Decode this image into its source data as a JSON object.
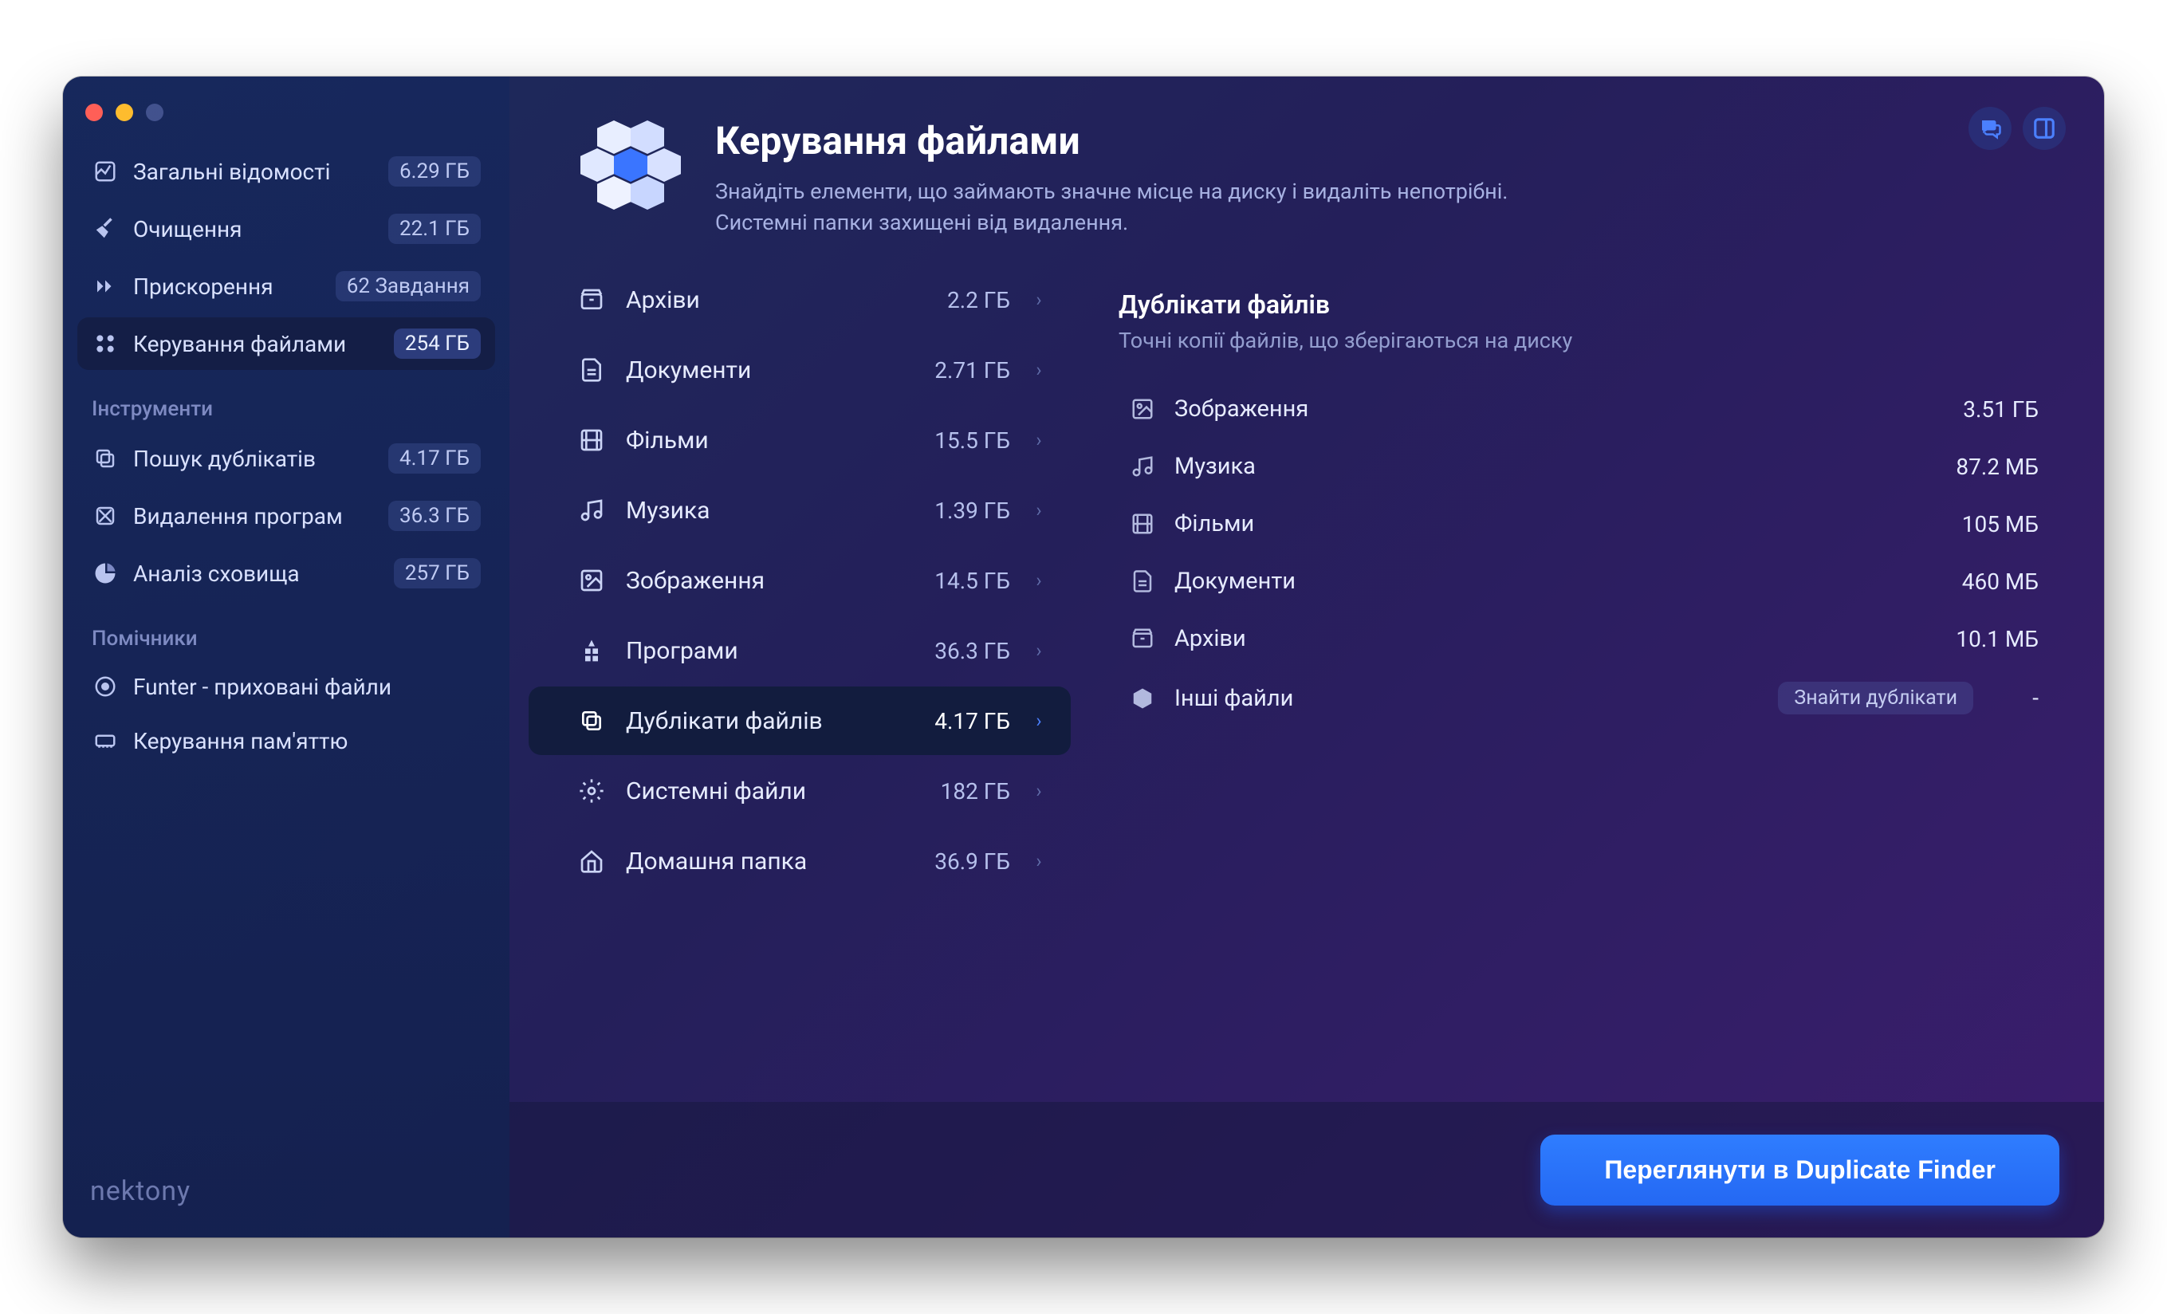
{
  "brand": "nektony",
  "sidebar": {
    "main": [
      {
        "label": "Загальні відомості",
        "size": "6.29 ГБ"
      },
      {
        "label": "Очищення",
        "size": "22.1 ГБ"
      },
      {
        "label": "Прискорення",
        "size": "62 Завдання"
      },
      {
        "label": "Керування файлами",
        "size": "254 ГБ"
      }
    ],
    "section_tools": "Інструменти",
    "tools": [
      {
        "label": "Пошук дублікатів",
        "size": "4.17 ГБ"
      },
      {
        "label": "Видалення програм",
        "size": "36.3 ГБ"
      },
      {
        "label": "Аналіз сховища",
        "size": "257 ГБ"
      }
    ],
    "section_helpers": "Помічники",
    "helpers": [
      {
        "label": "Funter - приховані файли"
      },
      {
        "label": "Керування пам'яттю"
      }
    ]
  },
  "header": {
    "title": "Керування файлами",
    "sub1": "Знайдіть елементи, що займають значне місце на диску і видаліть непотрібні.",
    "sub2": "Системні папки захищені від видалення."
  },
  "files": [
    {
      "label": "Архіви",
      "size": "2.2 ГБ"
    },
    {
      "label": "Документи",
      "size": "2.71 ГБ"
    },
    {
      "label": "Фільми",
      "size": "15.5 ГБ"
    },
    {
      "label": "Музика",
      "size": "1.39 ГБ"
    },
    {
      "label": "Зображення",
      "size": "14.5 ГБ"
    },
    {
      "label": "Програми",
      "size": "36.3 ГБ"
    },
    {
      "label": "Дублікати файлів",
      "size": "4.17 ГБ"
    },
    {
      "label": "Системні файли",
      "size": "182 ГБ"
    },
    {
      "label": "Домашня папка",
      "size": "36.9 ГБ"
    }
  ],
  "details": {
    "title": "Дублікати файлів",
    "sub": "Точні копії файлів, що зберігаються на диску",
    "rows": [
      {
        "label": "Зображення",
        "size": "3.51 ГБ"
      },
      {
        "label": "Музика",
        "size": "87.2 МБ"
      },
      {
        "label": "Фільми",
        "size": "105 МБ"
      },
      {
        "label": "Документи",
        "size": "460 МБ"
      },
      {
        "label": "Архіви",
        "size": "10.1 МБ"
      }
    ],
    "other_label": "Інші файли",
    "other_chip": "Знайти дублікати",
    "other_dash": "-"
  },
  "cta": "Переглянути в Duplicate Finder"
}
